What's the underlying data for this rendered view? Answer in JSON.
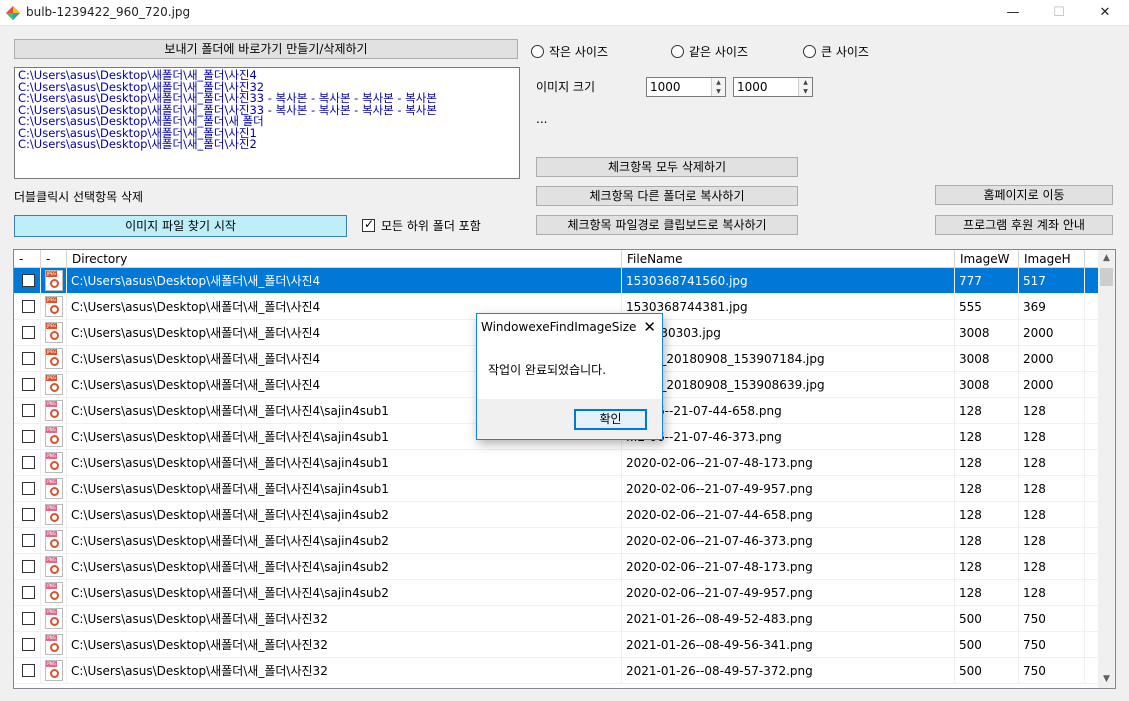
{
  "window": {
    "title": "bulb-1239422_960_720.jpg",
    "minimize": "—",
    "maximize": "☐",
    "close": "✕"
  },
  "controls": {
    "shortcut_button": "보내기 폴더에 바로가기 만들기/삭제하기",
    "path_list": [
      "C:\\Users\\asus\\Desktop\\새폴더\\새_폴더\\사진4",
      "C:\\Users\\asus\\Desktop\\새폴더\\새_폴더\\사진32",
      "C:\\Users\\asus\\Desktop\\새폴더\\새_폴더\\사진33 - 복사본 - 복사본 - 복사본 - 복사본",
      "C:\\Users\\asus\\Desktop\\새폴더\\새_폴더\\사진33 - 복사본 - 복사본 - 복사본 - 복사본",
      "C:\\Users\\asus\\Desktop\\새폴더\\새_폴더\\새 폴더",
      "C:\\Users\\asus\\Desktop\\새폴더\\새_폴더\\사진1",
      "C:\\Users\\asus\\Desktop\\새폴더\\새_폴더\\사진2"
    ],
    "double_click_label": "더블클릭시 선택항목 삭제",
    "start_button": "이미지 파일 찾기 시작",
    "include_subfolders": "모든 하위 폴더 포함",
    "radio_small": "작은 사이즈",
    "radio_same": "같은 사이즈",
    "radio_large": "큰 사이즈",
    "image_size_label": "이미지 크기",
    "width_value": "1000",
    "height_value": "1000",
    "ellipsis": "...",
    "delete_checked": "체크항목 모두 삭제하기",
    "copy_checked": "체크항목 다른 폴더로 복사하기",
    "copy_paths": "체크항목 파일경로 클립보드로 복사하기",
    "homepage": "홈페이지로 이동",
    "donation": "프로그램 후원 계좌 안내"
  },
  "grid": {
    "headers": [
      "-",
      "-",
      "Directory",
      "FileName",
      "ImageW",
      "ImageH"
    ],
    "rows": [
      {
        "dir": "C:\\Users\\asus\\Desktop\\새폴더\\새_폴더\\사진4",
        "file": "1530368741560.jpg",
        "w": "777",
        "h": "517",
        "type": "JPEG"
      },
      {
        "dir": "C:\\Users\\asus\\Desktop\\새폴더\\새_폴더\\사진4",
        "file": "1530368744381.jpg",
        "w": "555",
        "h": "369",
        "type": "JPEG"
      },
      {
        "dir": "C:\\Users\\asus\\Desktop\\새폴더\\새_폴더\\사진4",
        "file": "...08030303.jpg",
        "w": "3008",
        "h": "2000",
        "type": "JPEG"
      },
      {
        "dir": "C:\\Users\\asus\\Desktop\\새폴더\\새_폴더\\사진4",
        "file": "...Talk_20180908_153907184.jpg",
        "w": "3008",
        "h": "2000",
        "type": "JPEG"
      },
      {
        "dir": "C:\\Users\\asus\\Desktop\\새폴더\\새_폴더\\사진4",
        "file": "...Talk_20180908_153908639.jpg",
        "w": "3008",
        "h": "2000",
        "type": "JPEG"
      },
      {
        "dir": "C:\\Users\\asus\\Desktop\\새폴더\\새_폴더\\사진4\\sajin4sub1",
        "file": "...2-06--21-07-44-658.png",
        "w": "128",
        "h": "128",
        "type": "PNG"
      },
      {
        "dir": "C:\\Users\\asus\\Desktop\\새폴더\\새_폴더\\사진4\\sajin4sub1",
        "file": "...2-06--21-07-46-373.png",
        "w": "128",
        "h": "128",
        "type": "PNG"
      },
      {
        "dir": "C:\\Users\\asus\\Desktop\\새폴더\\새_폴더\\사진4\\sajin4sub1",
        "file": "2020-02-06--21-07-48-173.png",
        "w": "128",
        "h": "128",
        "type": "PNG"
      },
      {
        "dir": "C:\\Users\\asus\\Desktop\\새폴더\\새_폴더\\사진4\\sajin4sub1",
        "file": "2020-02-06--21-07-49-957.png",
        "w": "128",
        "h": "128",
        "type": "PNG"
      },
      {
        "dir": "C:\\Users\\asus\\Desktop\\새폴더\\새_폴더\\사진4\\sajin4sub2",
        "file": "2020-02-06--21-07-44-658.png",
        "w": "128",
        "h": "128",
        "type": "PNG"
      },
      {
        "dir": "C:\\Users\\asus\\Desktop\\새폴더\\새_폴더\\사진4\\sajin4sub2",
        "file": "2020-02-06--21-07-46-373.png",
        "w": "128",
        "h": "128",
        "type": "PNG"
      },
      {
        "dir": "C:\\Users\\asus\\Desktop\\새폴더\\새_폴더\\사진4\\sajin4sub2",
        "file": "2020-02-06--21-07-48-173.png",
        "w": "128",
        "h": "128",
        "type": "PNG"
      },
      {
        "dir": "C:\\Users\\asus\\Desktop\\새폴더\\새_폴더\\사진4\\sajin4sub2",
        "file": "2020-02-06--21-07-49-957.png",
        "w": "128",
        "h": "128",
        "type": "PNG"
      },
      {
        "dir": "C:\\Users\\asus\\Desktop\\새폴더\\새_폴더\\사진32",
        "file": "2021-01-26--08-49-52-483.png",
        "w": "500",
        "h": "750",
        "type": "PNG"
      },
      {
        "dir": "C:\\Users\\asus\\Desktop\\새폴더\\새_폴더\\사진32",
        "file": "2021-01-26--08-49-56-341.png",
        "w": "500",
        "h": "750",
        "type": "PNG"
      },
      {
        "dir": "C:\\Users\\asus\\Desktop\\새폴더\\새_폴더\\사진32",
        "file": "2021-01-26--08-49-57-372.png",
        "w": "500",
        "h": "750",
        "type": "PNG"
      }
    ]
  },
  "dialog": {
    "title": "WindowexeFindImageSize",
    "message": "작업이 완료되었습니다.",
    "ok": "확인",
    "close": "✕"
  },
  "colors": {
    "selection": "#0078d7",
    "jpeg_tag": "#d9532c",
    "png_tag": "#e06a8a"
  }
}
